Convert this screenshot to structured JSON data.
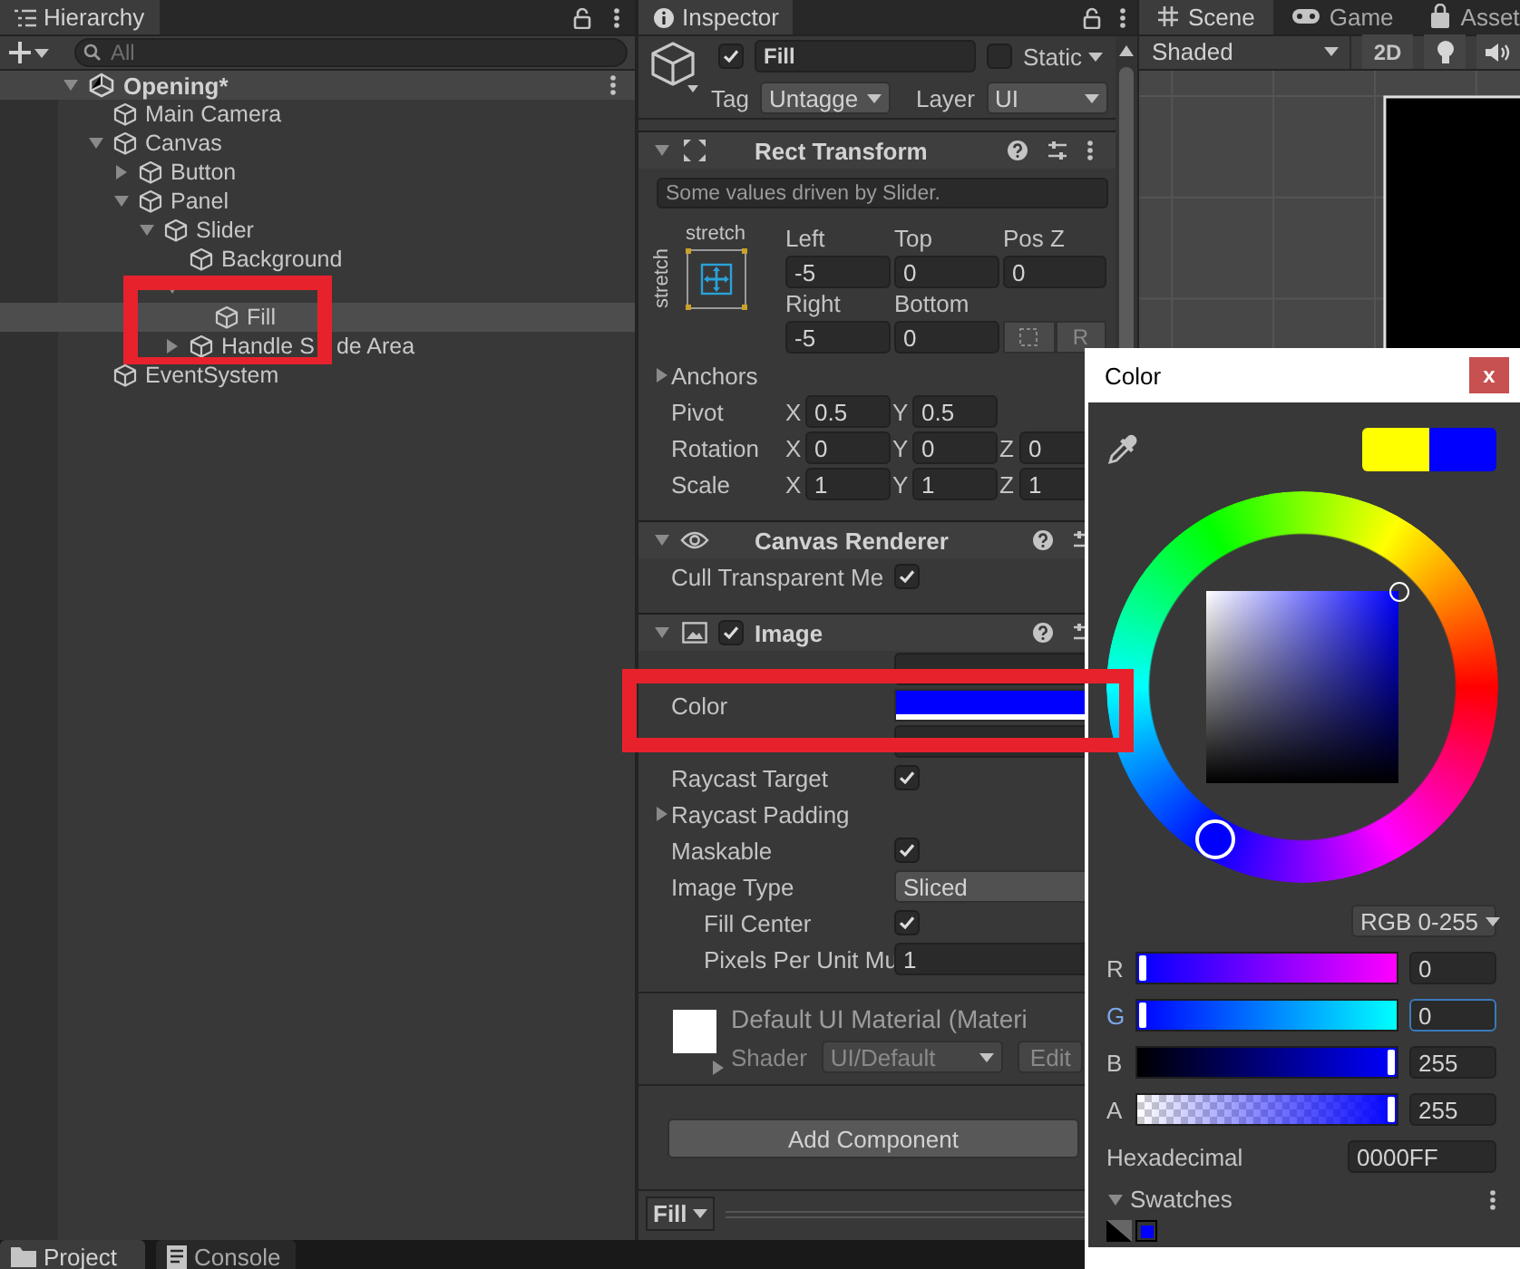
{
  "hierarchy": {
    "title": "Hierarchy",
    "search": {
      "placeholder": "All"
    },
    "scene": {
      "name": "Opening*",
      "expanded": true,
      "children": [
        {
          "name": "Main Camera",
          "selected": false
        },
        {
          "name": "Canvas",
          "selected": false,
          "expanded": true,
          "children": [
            {
              "name": "Button",
              "selected": false,
              "expanded": false
            },
            {
              "name": "Panel",
              "selected": false,
              "expanded": true,
              "children": [
                {
                  "name": "Slider",
                  "selected": false,
                  "expanded": true,
                  "children": [
                    {
                      "name": "Background",
                      "selected": false
                    },
                    {
                      "selected": false,
                      "expanded": true,
                      "children": [
                        {
                          "name": "Fill",
                          "selected": true
                        }
                      ]
                    },
                    {
                      "name_parts": [
                        "Handle S",
                        "de Area"
                      ],
                      "selected": false,
                      "expanded": false
                    }
                  ]
                }
              ]
            }
          ]
        },
        {
          "name": "EventSystem",
          "selected": false
        }
      ]
    }
  },
  "inspector": {
    "title": "Inspector",
    "object": {
      "active": true,
      "name": "Fill",
      "static": false,
      "static_label": "Static",
      "tag_label": "Tag",
      "tag": "Untagge",
      "layer_label": "Layer",
      "layer": "UI"
    },
    "components": [
      {
        "kind": "rect_transform",
        "title": "Rect Transform",
        "expanded": true,
        "note": "Some values driven by Slider.",
        "anchor_h": "stretch",
        "anchor_v": "stretch",
        "fields": [
          {
            "label": "Left",
            "value": "-5"
          },
          {
            "label": "Top",
            "value": "0"
          },
          {
            "label": "Pos Z",
            "value": "0"
          },
          {
            "label": "Right",
            "value": "-5"
          },
          {
            "label": "Bottom",
            "value": "0"
          }
        ],
        "raw_button": "R",
        "rows": [
          {
            "kind": "foldout",
            "label": "Anchors",
            "expanded": false
          },
          {
            "kind": "vector",
            "label": "Pivot",
            "axes": [
              {
                "axis": "X",
                "value": "0.5"
              },
              {
                "axis": "Y",
                "value": "0.5"
              }
            ]
          },
          {
            "kind": "vector",
            "label": "Rotation",
            "axes": [
              {
                "axis": "X",
                "value": "0"
              },
              {
                "axis": "Y",
                "value": "0"
              },
              {
                "axis": "Z",
                "value": "0"
              }
            ]
          },
          {
            "kind": "vector",
            "label": "Scale",
            "axes": [
              {
                "axis": "X",
                "value": "1"
              },
              {
                "axis": "Y",
                "value": "1"
              },
              {
                "axis": "Z",
                "value": "1"
              }
            ]
          }
        ]
      },
      {
        "kind": "canvas_renderer",
        "title": "Canvas Renderer",
        "expanded": true,
        "rows": [
          {
            "kind": "checkbox",
            "label": "Cull Transparent Me",
            "checked": true
          }
        ]
      },
      {
        "kind": "image",
        "title": "Image",
        "expanded": true,
        "enabled": true,
        "rows": [
          {
            "kind": "object"
          },
          {
            "kind": "color",
            "label": "Color",
            "color": "#0000ff"
          },
          {
            "kind": "object"
          },
          {
            "kind": "checkbox",
            "label": "Raycast Target",
            "checked": true
          },
          {
            "kind": "foldout",
            "label": "Raycast Padding",
            "expanded": false
          },
          {
            "kind": "checkbox",
            "label": "Maskable",
            "checked": true
          },
          {
            "kind": "dropdown",
            "label": "Image Type",
            "value": "Sliced",
            "children": [
              {
                "kind": "checkbox",
                "label": "Fill Center",
                "checked": true
              },
              {
                "kind": "number",
                "label": "Pixels Per Unit Mu",
                "value": "1"
              }
            ]
          }
        ]
      }
    ],
    "material": {
      "name": "Default UI Material (Materi",
      "expanded": false,
      "shader_label": "Shader",
      "shader": "UI/Default",
      "edit": "Edit"
    },
    "add_component": "Add Component",
    "footer": {
      "label": "Fill"
    }
  },
  "scene_view": {
    "tabs": [
      {
        "label": "Scene",
        "selected": true
      },
      {
        "label": "Game",
        "selected": false
      },
      {
        "label": "Asset",
        "selected": false
      }
    ],
    "shading": "Shaded",
    "mode_2d": "2D"
  },
  "color_picker": {
    "title": "Color",
    "close": "x",
    "preview": [
      {
        "color": "#ffff00"
      },
      {
        "color": "#0000ff"
      }
    ],
    "mode": "RGB 0-255",
    "channels": [
      {
        "name": "R",
        "level": 0,
        "value": "0",
        "focused": false
      },
      {
        "name": "G",
        "level": 0,
        "value": "0",
        "focused": true
      },
      {
        "name": "B",
        "level": 1,
        "value": "255",
        "focused": false
      },
      {
        "name": "A",
        "level": 1,
        "value": "255",
        "focused": false
      }
    ],
    "hex_label": "Hexadecimal",
    "hex": "0000FF",
    "swatches": {
      "label": "Swatches",
      "expanded": true,
      "items": [
        {
          "color": "#0000ff"
        }
      ]
    }
  },
  "bottom_tabs": [
    {
      "label": "Project",
      "selected": true
    },
    {
      "label": "Console",
      "selected": false
    }
  ]
}
